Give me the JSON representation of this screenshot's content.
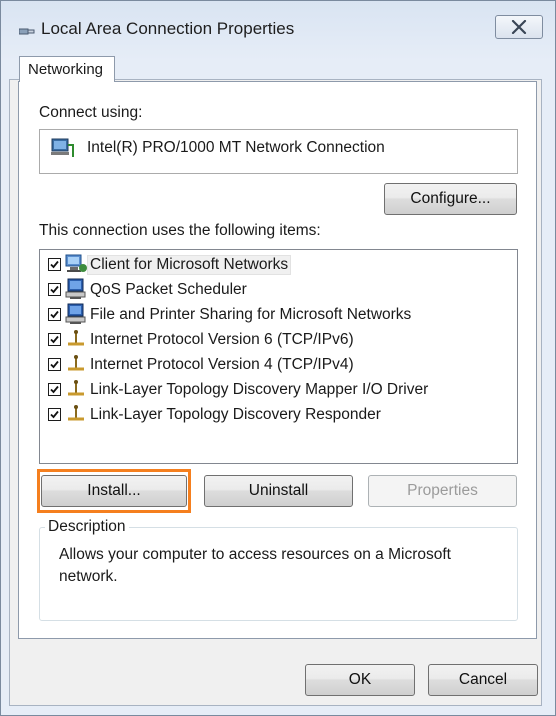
{
  "window": {
    "title": "Local Area Connection Properties",
    "close_label": "✕"
  },
  "tabs": [
    {
      "label": "Networking",
      "selected": true
    }
  ],
  "connect_using": {
    "label": "Connect using:",
    "adapter": "Intel(R) PRO/1000 MT Network Connection"
  },
  "configure_label": "Configure...",
  "items_label": "This connection uses the following items:",
  "items": [
    {
      "label": "Client for Microsoft Networks",
      "checked": true,
      "icon": "network-client-icon"
    },
    {
      "label": "QoS Packet Scheduler",
      "checked": true,
      "icon": "network-service-icon"
    },
    {
      "label": "File and Printer Sharing for Microsoft Networks",
      "checked": true,
      "icon": "network-service-icon"
    },
    {
      "label": "Internet Protocol Version 6 (TCP/IPv6)",
      "checked": true,
      "icon": "protocol-icon"
    },
    {
      "label": "Internet Protocol Version 4 (TCP/IPv4)",
      "checked": true,
      "icon": "protocol-icon"
    },
    {
      "label": "Link-Layer Topology Discovery Mapper I/O Driver",
      "checked": true,
      "icon": "protocol-icon"
    },
    {
      "label": "Link-Layer Topology Discovery Responder",
      "checked": true,
      "icon": "protocol-icon"
    }
  ],
  "buttons": {
    "install": "Install...",
    "uninstall": "Uninstall",
    "properties": "Properties",
    "ok": "OK",
    "cancel": "Cancel"
  },
  "description": {
    "legend": "Description",
    "text": "Allows your computer to access resources on a Microsoft network."
  },
  "colors": {
    "highlight": "#f57f1e",
    "panel": "#ffffff",
    "chrome": "#e6edf7"
  }
}
